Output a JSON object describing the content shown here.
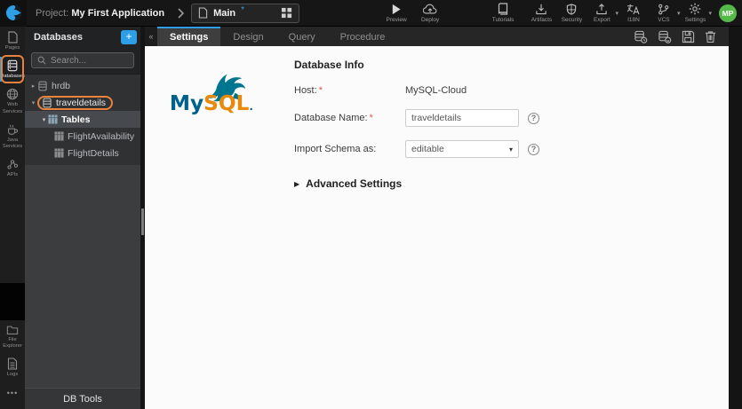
{
  "colors": {
    "accent_blue": "#2e9fe6",
    "annotation_orange": "#e8823c",
    "avatar_green": "#54b948",
    "asterisk_red": "#e05a4e",
    "mysql_blue": "#00618a",
    "mysql_teal": "#00758f",
    "mysql_orange": "#e8890c"
  },
  "topbar": {
    "project_prefix": "Project:",
    "project_name": "My First Application",
    "page_selector": {
      "label": "Main",
      "modified_marker": "*"
    },
    "preview_label": "Preview",
    "deploy_label": "Deploy",
    "tutorials_label": "Tutorials",
    "artifacts_label": "Artifacts",
    "security_label": "Security",
    "export_label": "Export",
    "i18n_label": "I18N",
    "vcs_label": "VCS",
    "settings_label": "Settings",
    "caret_glyph": "▾",
    "avatar_initials": "MP"
  },
  "activity_bar": {
    "items": [
      {
        "label": "Pages"
      },
      {
        "label": "Databases"
      },
      {
        "label": "Web Services"
      },
      {
        "label": "Java Services"
      },
      {
        "label": "APIs"
      }
    ],
    "bottom_items": [
      {
        "label": "File Explorer"
      },
      {
        "label": "Logs"
      }
    ],
    "more_glyph": "•••"
  },
  "db_panel": {
    "title": "Databases",
    "add_button": "+",
    "collapse_glyph": "«",
    "search_placeholder": "Search...",
    "collapsed_glyph": "▸",
    "expanded_glyph": "▾",
    "tree": [
      {
        "label": "hrdb"
      },
      {
        "label": "traveldetails"
      },
      {
        "label": "Tables"
      },
      {
        "label": "FlightAvailability"
      },
      {
        "label": "FlightDetails"
      }
    ],
    "db_tools_label": "DB Tools"
  },
  "main": {
    "tabs": [
      {
        "label": "Settings"
      },
      {
        "label": "Design"
      },
      {
        "label": "Query"
      },
      {
        "label": "Procedure"
      }
    ],
    "mysql_logo": {
      "my": "My",
      "sql": "SQL",
      "dot": "."
    },
    "form": {
      "heading": "Database Info",
      "required_marker": "*",
      "host_label": "Host:",
      "host_value": "MySQL-Cloud",
      "dbname_label": "Database Name:",
      "dbname_value": "traveldetails",
      "schema_label": "Import Schema as:",
      "schema_value": "editable",
      "select_caret": "▾",
      "help_glyph": "?",
      "advanced_caret": "▶",
      "advanced_label": "Advanced Settings"
    }
  }
}
